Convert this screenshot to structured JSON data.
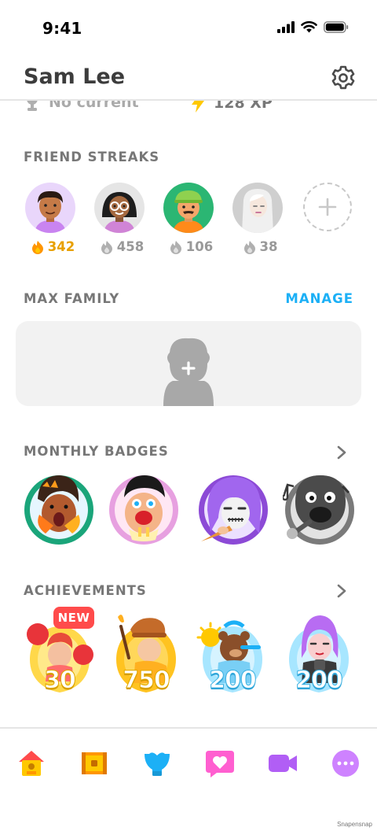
{
  "status_bar": {
    "time": "9:41"
  },
  "profile": {
    "name": "Sam Lee"
  },
  "stats": {
    "league": "No current",
    "xp": "128 XP"
  },
  "friend_streaks": {
    "title": "FRIEND STREAKS",
    "friends": [
      {
        "streak": "342",
        "active": true
      },
      {
        "streak": "458",
        "active": false
      },
      {
        "streak": "106",
        "active": false
      },
      {
        "streak": "38",
        "active": false
      }
    ]
  },
  "max_family": {
    "title": "MAX FAMILY",
    "manage_label": "MANAGE"
  },
  "monthly_badges": {
    "title": "MONTHLY BADGES"
  },
  "achievements": {
    "title": "ACHIEVEMENTS",
    "new_label": "NEW",
    "items": [
      {
        "value": "30",
        "color": "#ffc800"
      },
      {
        "value": "750",
        "color": "#ffc800"
      },
      {
        "value": "200",
        "color": "#7fd8ff"
      },
      {
        "value": "200",
        "color": "#7fd8ff"
      }
    ]
  },
  "tabs": [
    "home-icon",
    "chest-icon",
    "shield-icon",
    "heart-icon",
    "video-icon",
    "more-icon"
  ],
  "credit": "Snapensnap",
  "colors": {
    "accent_blue": "#1cb0f6",
    "streak_orange": "#e8a000",
    "new_red": "#ff4b4b"
  }
}
